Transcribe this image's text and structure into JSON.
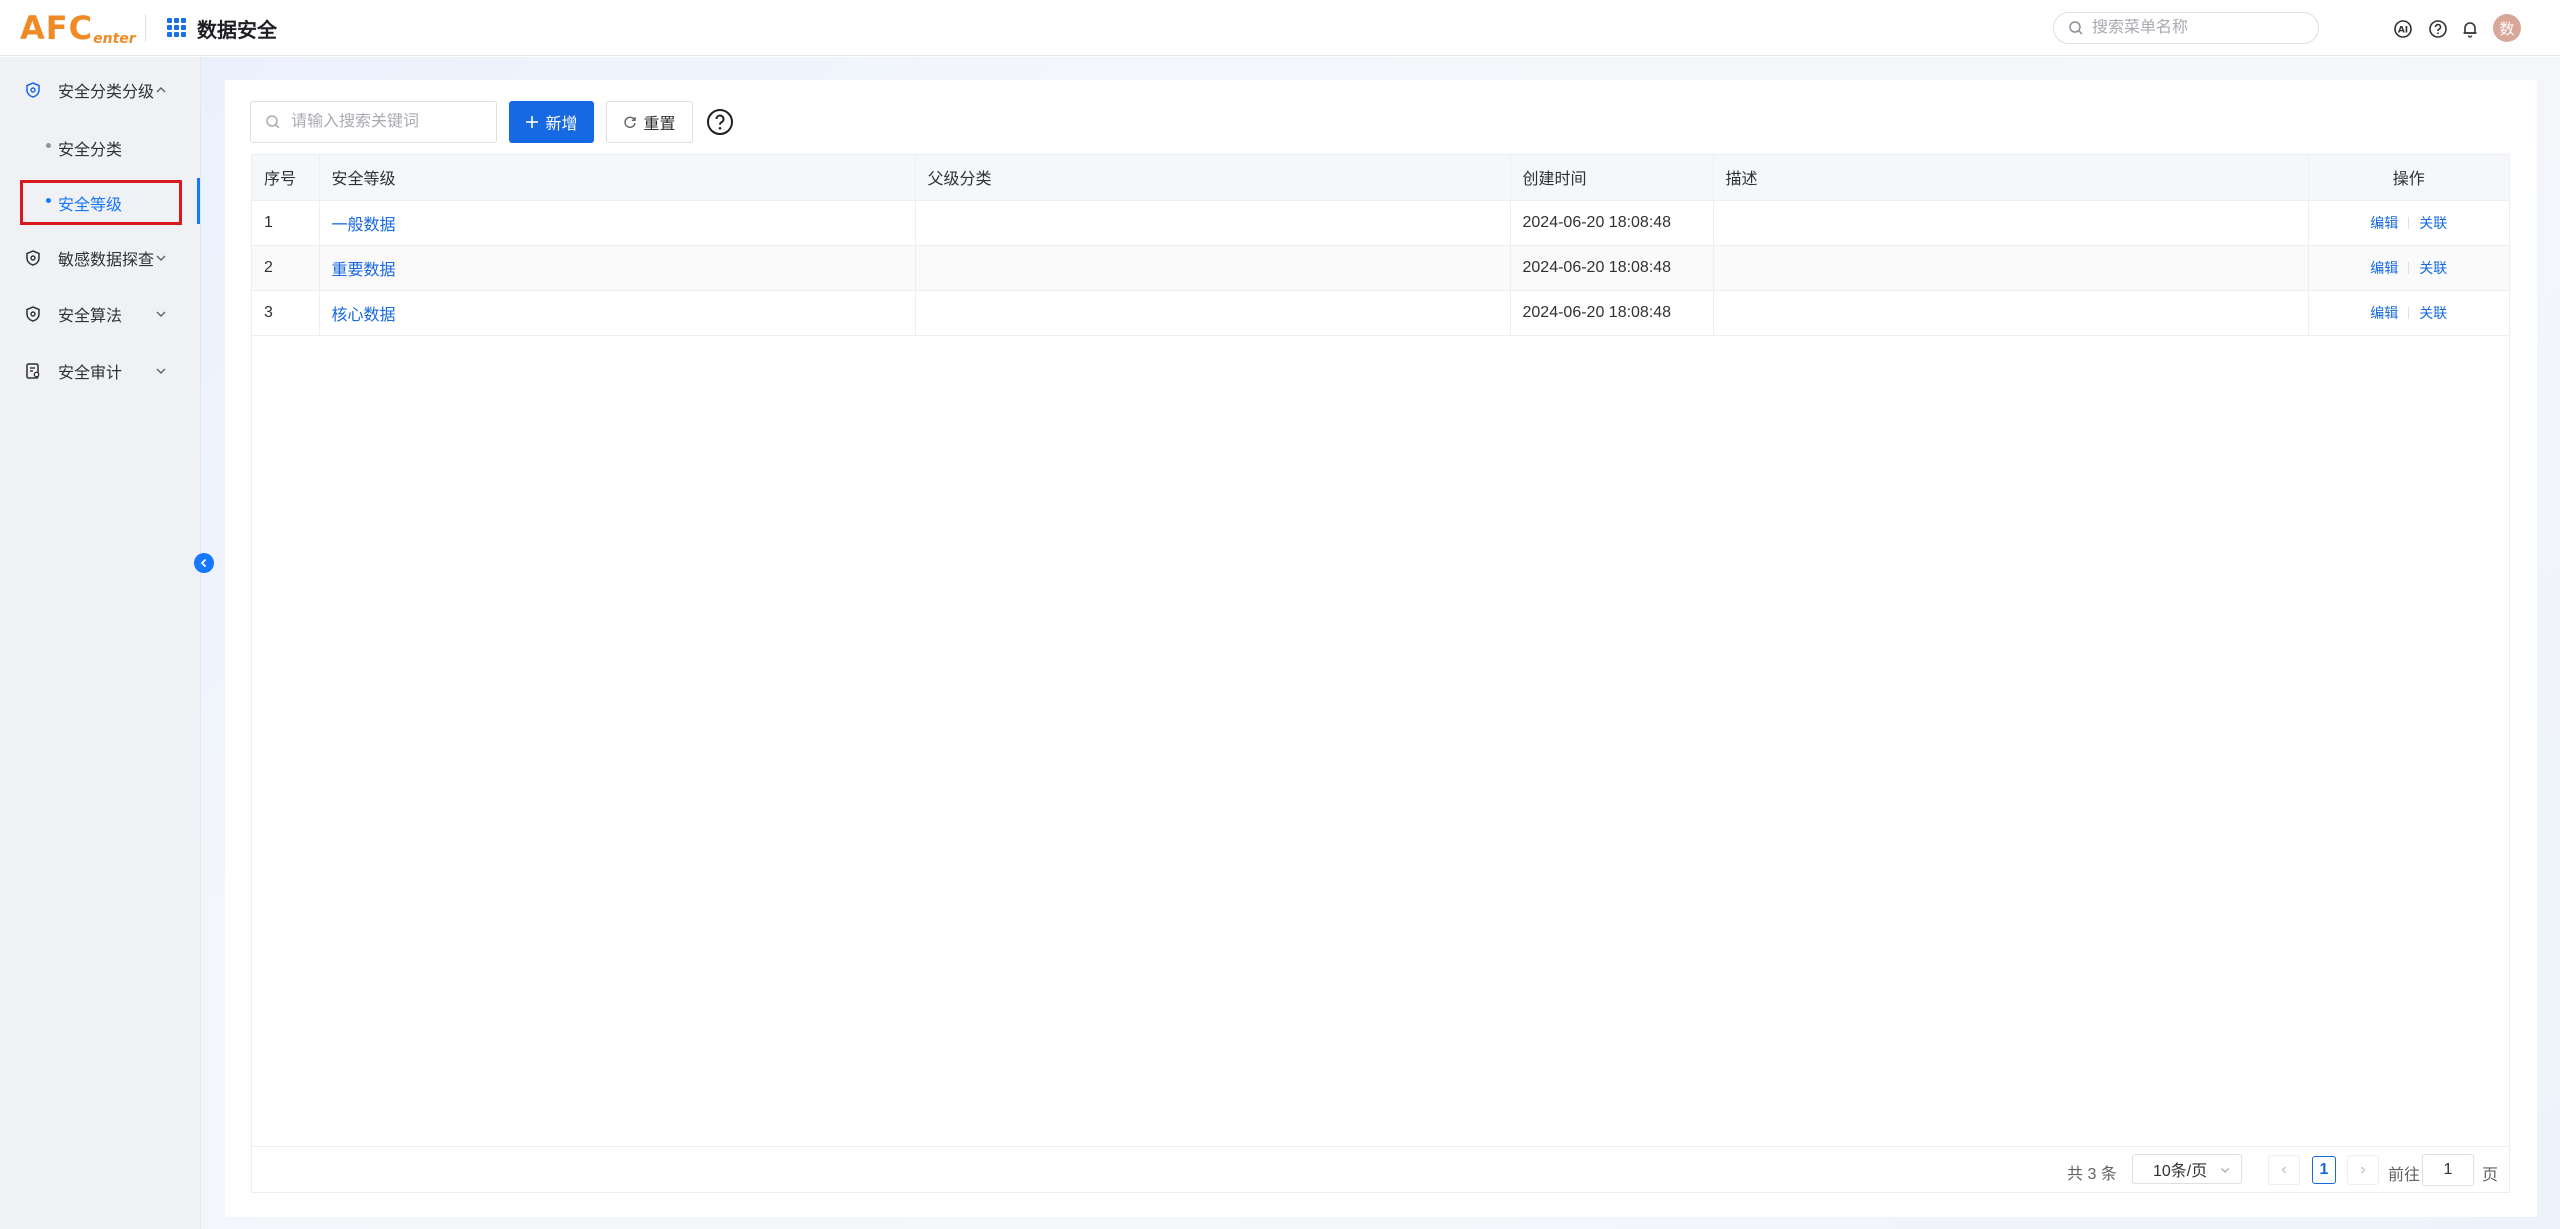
{
  "header": {
    "logo_main": "AFC",
    "logo_sub": "enter",
    "app_title": "数据安全",
    "search_placeholder": "搜索菜单名称",
    "avatar_text": "数",
    "icons": [
      "ai-icon",
      "help-icon",
      "bell-icon"
    ]
  },
  "sidebar": {
    "items": [
      {
        "label": "安全分类分级",
        "icon": "shield-icon",
        "expanded": true
      },
      {
        "label": "安全分类",
        "sub": true
      },
      {
        "label": "安全等级",
        "sub": true,
        "active": true
      },
      {
        "label": "敏感数据探查",
        "icon": "shield-icon",
        "expanded": false
      },
      {
        "label": "安全算法",
        "icon": "shield-icon",
        "expanded": false
      },
      {
        "label": "安全审计",
        "icon": "audit-icon",
        "expanded": false
      }
    ]
  },
  "toolbar": {
    "keyword_placeholder": "请输入搜索关键词",
    "add_label": "新增",
    "reset_label": "重置"
  },
  "table": {
    "columns": [
      "序号",
      "安全等级",
      "父级分类",
      "创建时间",
      "描述",
      "操作"
    ],
    "rows": [
      {
        "index": "1",
        "level": "一般数据",
        "parent": "",
        "created": "2024-06-20 18:08:48",
        "desc": ""
      },
      {
        "index": "2",
        "level": "重要数据",
        "parent": "",
        "created": "2024-06-20 18:08:48",
        "desc": ""
      },
      {
        "index": "3",
        "level": "核心数据",
        "parent": "",
        "created": "2024-06-20 18:08:48",
        "desc": ""
      }
    ],
    "actions": {
      "edit": "编辑",
      "link": "关联"
    }
  },
  "pagination": {
    "total": "共 3 条",
    "page_size": "10条/页",
    "current_page": "1",
    "goto_label": "前往",
    "goto_value": "1",
    "goto_suffix": "页"
  },
  "colors": {
    "accent": "#1668e3",
    "logo": "#f08a24",
    "highlight": "#d9191c"
  }
}
